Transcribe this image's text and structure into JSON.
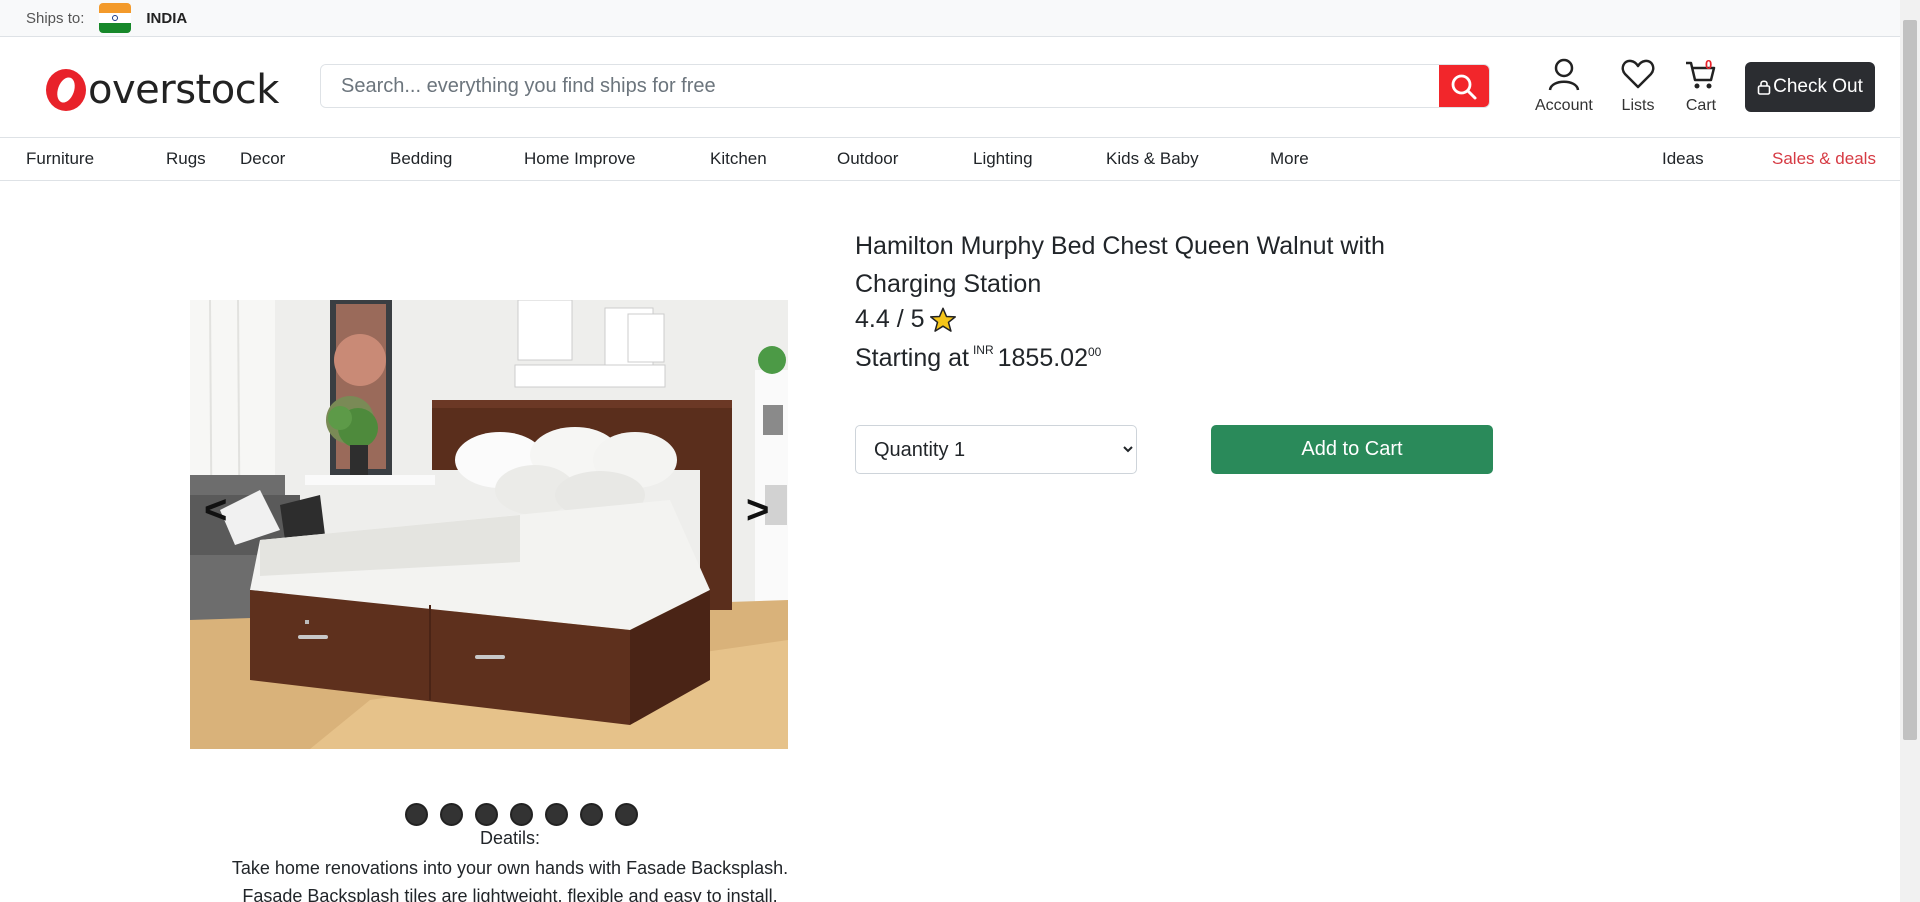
{
  "topbar": {
    "ships_label": "Ships to:",
    "country": "INDIA"
  },
  "header": {
    "logo_text": "overstock",
    "search_placeholder": "Search... everything you find ships for free",
    "account_label": "Account",
    "lists_label": "Lists",
    "cart_label": "Cart",
    "cart_count": "0",
    "checkout_label": "Check Out"
  },
  "nav": {
    "items": [
      "Furniture",
      "Rugs",
      "Decor",
      "Bedding",
      "Home Improve",
      "Kitchen",
      "Outdoor",
      "Lighting",
      "Kids & Baby",
      "More"
    ],
    "ideas": "Ideas",
    "sales": "Sales & deals"
  },
  "product": {
    "title": "Hamilton Murphy Bed Chest Queen Walnut with Charging Station",
    "rating": "4.4 / 5",
    "price_prefix": "Starting at",
    "currency": "INR",
    "price_main": "1855.02",
    "price_cents": "00",
    "quantity_selected": "Quantity 1",
    "add_to_cart": "Add to Cart"
  },
  "carousel": {
    "prev": "<",
    "next": ">",
    "dot_count": 7
  },
  "details": {
    "title": "Deatils:",
    "text_line1": "Take home renovations into your own hands with Fasade Backsplash.",
    "text_line2": "Fasade Backsplash tiles are lightweight, flexible and easy to install,"
  },
  "colors": {
    "brand_red": "#e8222a",
    "add_to_cart_green": "#2a8a5a",
    "checkout_dark": "#2b2d31",
    "sales_red": "#d63a43"
  }
}
